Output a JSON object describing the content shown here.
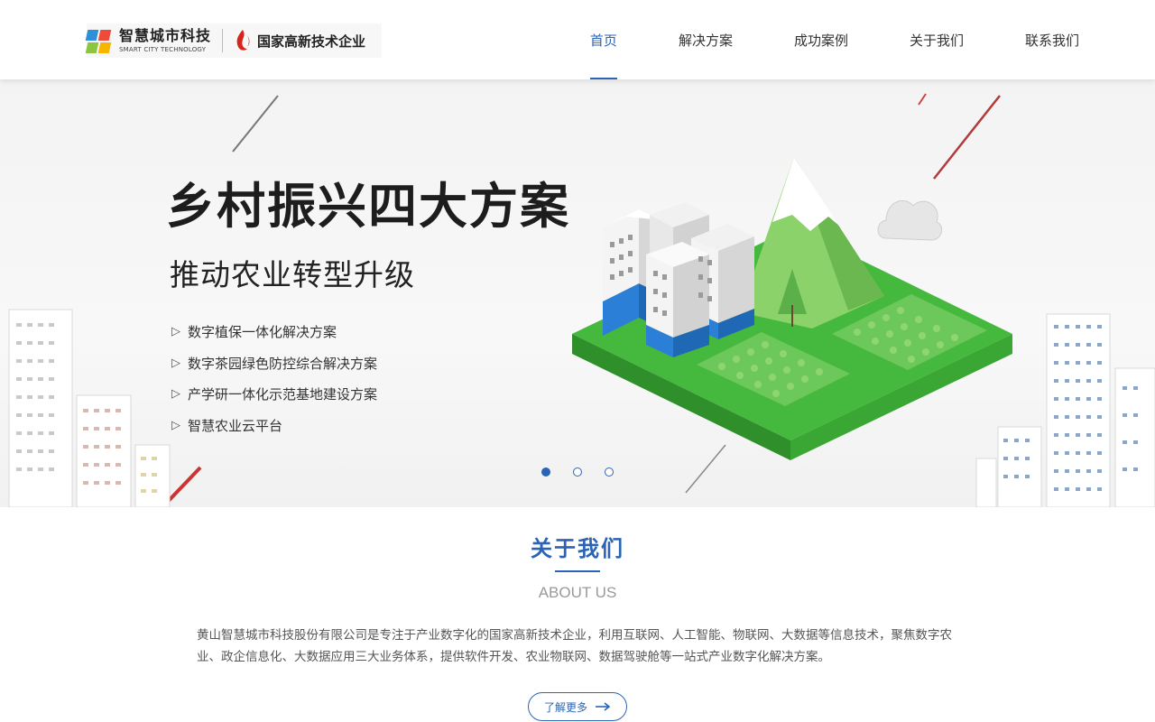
{
  "header": {
    "logo_cn": "智慧城市科技",
    "logo_en": "SMART CITY TECHNOLOGY",
    "logo_badge": "国家高新技术企业",
    "nav": [
      {
        "label": "首页",
        "active": true
      },
      {
        "label": "解决方案",
        "active": false
      },
      {
        "label": "成功案例",
        "active": false
      },
      {
        "label": "关于我们",
        "active": false
      },
      {
        "label": "联系我们",
        "active": false
      }
    ]
  },
  "banner": {
    "title": "乡村振兴四大方案",
    "subtitle": "推动农业转型升级",
    "items": [
      "数字植保一体化解决方案",
      "数字茶园绿色防控综合解决方案",
      "产学研一体化示范基地建设方案",
      "智慧农业云平台"
    ],
    "slide_count": 3,
    "active_slide": 1
  },
  "about": {
    "title": "关于我们",
    "subtitle_en": "ABOUT US",
    "description": "黄山智慧城市科技股份有限公司是专注于产业数字化的国家高新技术企业，利用互联网、人工智能、物联网、大数据等信息技术，聚焦数字农业、政企信息化、大数据应用三大业务体系，提供软件开发、农业物联网、数据驾驶舱等一站式产业数字化解决方案。",
    "more_label": "了解更多"
  },
  "colors": {
    "accent": "#2b64b5",
    "grass": "#3fae3a",
    "building_blue": "#2b7fd6"
  }
}
